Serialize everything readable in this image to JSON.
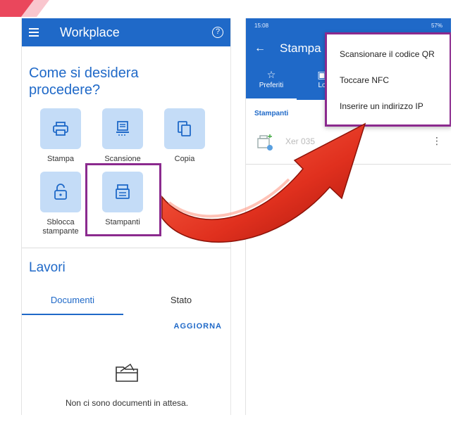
{
  "left": {
    "app_title": "Workplace",
    "help_icon": "?",
    "question": "Come si desidera procedere?",
    "tiles": [
      {
        "label": "Stampa",
        "icon": "printer-icon"
      },
      {
        "label": "Scansione",
        "icon": "scanner-icon"
      },
      {
        "label": "Copia",
        "icon": "copy-icon"
      },
      {
        "label": "Sblocca stampante",
        "icon": "unlock-icon"
      },
      {
        "label": "Stampanti",
        "icon": "printer-list-icon"
      }
    ],
    "section_title": "Lavori",
    "tabs": [
      "Documenti",
      "Stato"
    ],
    "active_tab": "Documenti",
    "refresh_label": "AGGIORNA",
    "empty_message": "Non ci sono documenti in attesa."
  },
  "right": {
    "status_time": "15:08",
    "status_right": "57%",
    "title": "Stampa",
    "tabs": [
      {
        "label": "Preferiti",
        "icon": "star-icon"
      },
      {
        "label": "Lo",
        "icon": "location-icon"
      }
    ],
    "section_label": "Stampanti",
    "printer_name": "Xer      035",
    "menu_items": [
      "Scansionare il codice QR",
      "Toccare NFC",
      "Inserire un indirizzo IP"
    ]
  },
  "colors": {
    "primary": "#1f69c8",
    "tile_bg": "#c4dcf7",
    "highlight": "#8b2a8e",
    "arrow": "#e0301e"
  }
}
